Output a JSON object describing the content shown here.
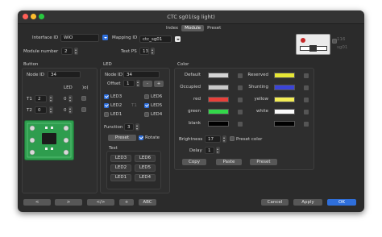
{
  "window": {
    "title": "CTC sg01(sg light)",
    "tabs": [
      "Index",
      "Module",
      "Preset"
    ],
    "active_tab": "Module"
  },
  "header": {
    "interface_id_label": "Interface ID",
    "interface_id_value": "WIO",
    "mapping_id_label": "Mapping ID",
    "mapping_id_value": "ctc_sg01",
    "module_number_label": "Module number",
    "module_number_value": "2",
    "text_ps_label": "Text PS",
    "text_ps_value": "13",
    "preview_num": "116",
    "preview_id": "sg01"
  },
  "button_panel": {
    "title": "Button",
    "node_id_label": "Node ID",
    "node_id_value": "34",
    "led_label": "LED",
    "col_label": ")o(",
    "rows": [
      {
        "label": "T1",
        "value": "2",
        "led": "0"
      },
      {
        "label": "T2",
        "value": "0",
        "led": "0"
      }
    ]
  },
  "led_panel": {
    "title": "LED",
    "node_id_label": "Node ID",
    "node_id_value": "34",
    "offset_label": "Offset",
    "offset_value": "1",
    "minus_label": "-",
    "plus_label": "+",
    "leds": [
      {
        "label": "LED3",
        "checked": true
      },
      {
        "label": "LED6",
        "checked": false
      },
      {
        "label": "LED2",
        "checked": true
      },
      {
        "label": "LED5",
        "checked": true
      },
      {
        "label": "LED1",
        "checked": false
      },
      {
        "label": "LED4",
        "checked": false
      }
    ],
    "t1_label": "T1",
    "function_label": "Function",
    "function_value": "3",
    "preset_label": "Preset",
    "rotate_label": "Rotate",
    "test_label": "Test",
    "test_buttons": [
      "LED3",
      "LED6",
      "LED2",
      "LED5",
      "LED1",
      "LED4"
    ]
  },
  "color_panel": {
    "title": "Color",
    "left": [
      {
        "label": "Default",
        "color": "#d4d4d4"
      },
      {
        "label": "Occupied",
        "color": "#c9c9c9"
      },
      {
        "label": "red",
        "color": "#e8403a"
      },
      {
        "label": "green",
        "color": "#33d84a"
      },
      {
        "label": "blank",
        "color": "#000000"
      }
    ],
    "right": [
      {
        "label": "Reserved",
        "color": "#e6e635"
      },
      {
        "label": "Shunting",
        "color": "#3b44d8"
      },
      {
        "label": "yellow",
        "color": "#f2ec55"
      },
      {
        "label": "white",
        "color": "#fafafa"
      },
      {
        "label": "",
        "color": "#000000"
      }
    ],
    "brightness_label": "Brightness",
    "brightness_value": "17",
    "preset_color_label": "Preset color",
    "delay_label": "Delay",
    "delay_value": "1",
    "buttons": [
      "Copy",
      "Paste",
      "Preset"
    ]
  },
  "footer": {
    "nav": [
      "<",
      ">",
      "</>",
      "+",
      "ABC"
    ],
    "cancel": "Cancel",
    "apply": "Apply",
    "ok": "OK"
  },
  "colors": {
    "accent": "#2f6fdb",
    "window_bg": "#2b2b2b",
    "traffic_red": "#ff5f57",
    "traffic_yellow": "#febc2e",
    "traffic_green": "#28c840"
  }
}
